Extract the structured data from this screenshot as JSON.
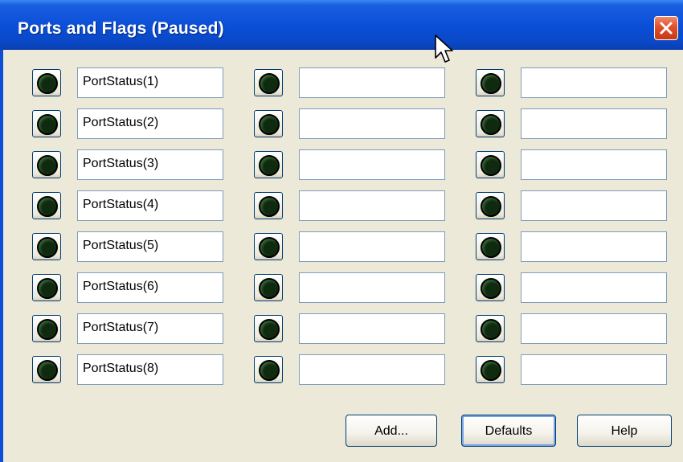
{
  "window": {
    "title": "Ports and Flags (Paused)"
  },
  "grid": {
    "col1": [
      "PortStatus(1)",
      "PortStatus(2)",
      "PortStatus(3)",
      "PortStatus(4)",
      "PortStatus(5)",
      "PortStatus(6)",
      "PortStatus(7)",
      "PortStatus(8)"
    ],
    "col2": [
      "",
      "",
      "",
      "",
      "",
      "",
      "",
      ""
    ],
    "col3": [
      "",
      "",
      "",
      "",
      "",
      "",
      "",
      ""
    ]
  },
  "buttons": {
    "add": "Add...",
    "defaults": "Defaults",
    "help": "Help"
  },
  "colors": {
    "titlebar": "#0a4fd6",
    "dialog_bg": "#ece9d8",
    "close": "#e0502a",
    "led_off": "#0f2a0f"
  },
  "icons": {
    "close": "close-icon",
    "cursor": "mouse-pointer-icon",
    "led": "led-indicator-icon"
  }
}
